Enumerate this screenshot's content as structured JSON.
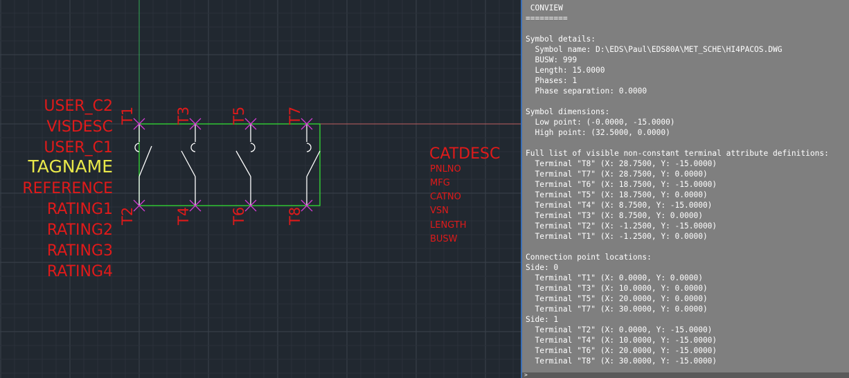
{
  "colors": {
    "background": "#212830",
    "grid_minor": "#2a313a",
    "grid_major": "#3a424c",
    "attribute_red": "#e01a1a",
    "tagname_yellow": "#e8e84a",
    "symbol_green": "#33dd33",
    "terminal_magenta": "#d23bd2",
    "switch_white": "#ffffff",
    "text_window_bg": "#7f7f7f",
    "text_window_fg": "#ffffff"
  },
  "drawing": {
    "left_attributes": [
      "USER_C2",
      "VISDESC",
      "USER_C1",
      "TAGNAME",
      "REFERENCE",
      "RATING1",
      "RATING2",
      "RATING3",
      "RATING4"
    ],
    "right_attributes_large": "CATDESC",
    "right_attributes_small": [
      "PNLNO",
      "MFG",
      "CATNO",
      "VSN",
      "LENGTH",
      "BUSW"
    ],
    "terminal_labels_top": [
      "T1",
      "T3",
      "T5",
      "T7"
    ],
    "terminal_labels_bottom": [
      "T2",
      "T4",
      "T6",
      "T8"
    ]
  },
  "text_window": {
    "lines": [
      " CONVIEW",
      "=========",
      "",
      "Symbol details:",
      "  Symbol name: D:\\EDS\\Paul\\EDS80A\\MET_SCHE\\HI4PACOS.DWG",
      "  BUSW: 999",
      "  Length: 15.0000",
      "  Phases: 1",
      "  Phase separation: 0.0000",
      "",
      "Symbol dimensions:",
      "  Low point: (-0.0000, -15.0000)",
      "  High point: (32.5000, 0.0000)",
      "",
      "Full list of visible non-constant terminal attribute definitions:",
      "  Terminal \"T8\" (X: 28.7500, Y: -15.0000)",
      "  Terminal \"T7\" (X: 28.7500, Y: 0.0000)",
      "  Terminal \"T6\" (X: 18.7500, Y: -15.0000)",
      "  Terminal \"T5\" (X: 18.7500, Y: 0.0000)",
      "  Terminal \"T4\" (X: 8.7500, Y: -15.0000)",
      "  Terminal \"T3\" (X: 8.7500, Y: 0.0000)",
      "  Terminal \"T2\" (X: -1.2500, Y: -15.0000)",
      "  Terminal \"T1\" (X: -1.2500, Y: 0.0000)",
      "",
      "Connection point locations:",
      "Side: 0",
      "  Terminal \"T1\" (X: 0.0000, Y: 0.0000)",
      "  Terminal \"T3\" (X: 10.0000, Y: 0.0000)",
      "  Terminal \"T5\" (X: 20.0000, Y: 0.0000)",
      "  Terminal \"T7\" (X: 30.0000, Y: 0.0000)",
      "Side: 1",
      "  Terminal \"T2\" (X: 0.0000, Y: -15.0000)",
      "  Terminal \"T4\" (X: 10.0000, Y: -15.0000)",
      "  Terminal \"T6\" (X: 20.0000, Y: -15.0000)",
      "  Terminal \"T8\" (X: 30.0000, Y: -15.0000)"
    ],
    "prompt": ">"
  }
}
